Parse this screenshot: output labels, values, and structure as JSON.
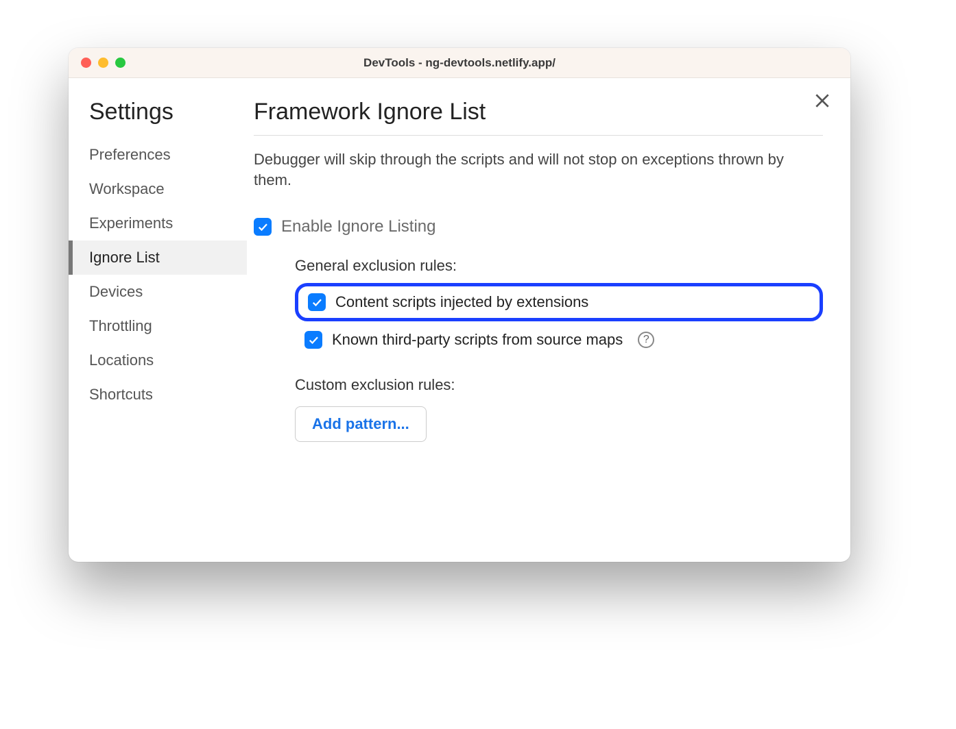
{
  "window": {
    "title": "DevTools - ng-devtools.netlify.app/"
  },
  "sidebar": {
    "title": "Settings",
    "items": [
      {
        "label": "Preferences",
        "active": false
      },
      {
        "label": "Workspace",
        "active": false
      },
      {
        "label": "Experiments",
        "active": false
      },
      {
        "label": "Ignore List",
        "active": true
      },
      {
        "label": "Devices",
        "active": false
      },
      {
        "label": "Throttling",
        "active": false
      },
      {
        "label": "Locations",
        "active": false
      },
      {
        "label": "Shortcuts",
        "active": false
      }
    ]
  },
  "content": {
    "title": "Framework Ignore List",
    "description": "Debugger will skip through the scripts and will not stop on exceptions thrown by them.",
    "enable_label": "Enable Ignore Listing",
    "general_rules_label": "General exclusion rules:",
    "rule_content_scripts": "Content scripts injected by extensions",
    "rule_third_party": "Known third-party scripts from source maps",
    "custom_rules_label": "Custom exclusion rules:",
    "add_pattern_label": "Add pattern...",
    "help_tooltip": "?"
  },
  "checkboxes": {
    "enable_ignore_listing": true,
    "content_scripts": true,
    "third_party_scripts": true
  },
  "colors": {
    "accent_checkbox": "#0a7cff",
    "highlight_border": "#1a3fff",
    "link_blue": "#1a73e8"
  }
}
